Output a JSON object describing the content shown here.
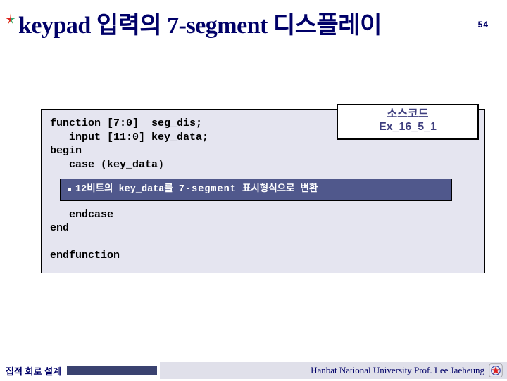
{
  "header": {
    "title": "keypad 입력의 7-segment 디스플레이",
    "page_number": "54"
  },
  "source_label": {
    "line1": "소스코드",
    "line2": "Ex_16_5_1"
  },
  "code": {
    "l1": "function [7:0]  seg_dis;",
    "l2": "   input [11:0] key_data;",
    "l3": "begin",
    "l4": "   case (key_data)",
    "note_prefix": "12비트의 ",
    "note_key": "key_data",
    "note_mid": "를 ",
    "note_seg": "7-segment",
    "note_suffix": " 표시형식으로 변환",
    "l7": "   endcase",
    "l8": "end",
    "l10": "endfunction"
  },
  "footer": {
    "left": "집적 회로 설계",
    "right": "Hanbat National University Prof. Lee Jaeheung"
  },
  "icons": {
    "star": "star-icon",
    "logo": "university-logo-icon"
  }
}
